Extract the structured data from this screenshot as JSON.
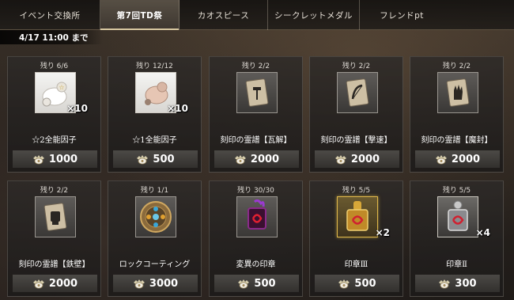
{
  "tabs": [
    {
      "label": "イベント交換所",
      "active": false
    },
    {
      "label": "第7回TD祭",
      "active": true
    },
    {
      "label": "カオスピース",
      "active": false
    },
    {
      "label": "シークレットメダル",
      "active": false
    },
    {
      "label": "フレンドpt",
      "active": false
    }
  ],
  "deadline": "4/17  11:00 まで",
  "currency_icon": "medal-coin-icon",
  "items": [
    {
      "remain": "残り 6/6",
      "name": "☆2全能因子",
      "price": "1000",
      "qty": "×10",
      "icon": "white-slime-factor-icon",
      "frame": "white"
    },
    {
      "remain": "残り 12/12",
      "name": "☆1全能因子",
      "price": "500",
      "qty": "×10",
      "icon": "tan-slime-factor-icon",
      "frame": "white"
    },
    {
      "remain": "残り 2/2",
      "name": "刻印の霊譜【瓦解】",
      "price": "2000",
      "qty": "",
      "icon": "scroll-hammer-icon",
      "frame": "normal"
    },
    {
      "remain": "残り 2/2",
      "name": "刻印の霊譜【撃速】",
      "price": "2000",
      "qty": "",
      "icon": "scroll-bow-icon",
      "frame": "normal"
    },
    {
      "remain": "残り 2/2",
      "name": "刻印の霊譜【魔封】",
      "price": "2000",
      "qty": "",
      "icon": "scroll-hand-icon",
      "frame": "normal"
    },
    {
      "remain": "残り 2/2",
      "name": "刻印の霊譜【鉄壁】",
      "price": "2000",
      "qty": "",
      "icon": "scroll-fist-icon",
      "frame": "normal"
    },
    {
      "remain": "残り 1/1",
      "name": "ロックコーティング",
      "price": "3000",
      "qty": "",
      "icon": "gem-disc-icon",
      "frame": "normal"
    },
    {
      "remain": "残り 30/30",
      "name": "変異の印章",
      "price": "500",
      "qty": "",
      "icon": "purple-seal-icon",
      "frame": "normal"
    },
    {
      "remain": "残り 5/5",
      "name": "印章Ⅲ",
      "price": "500",
      "qty": "×2",
      "icon": "gold-seal-icon",
      "frame": "gold"
    },
    {
      "remain": "残り 5/5",
      "name": "印章Ⅱ",
      "price": "300",
      "qty": "×4",
      "icon": "silver-seal-icon",
      "frame": "silver"
    }
  ]
}
